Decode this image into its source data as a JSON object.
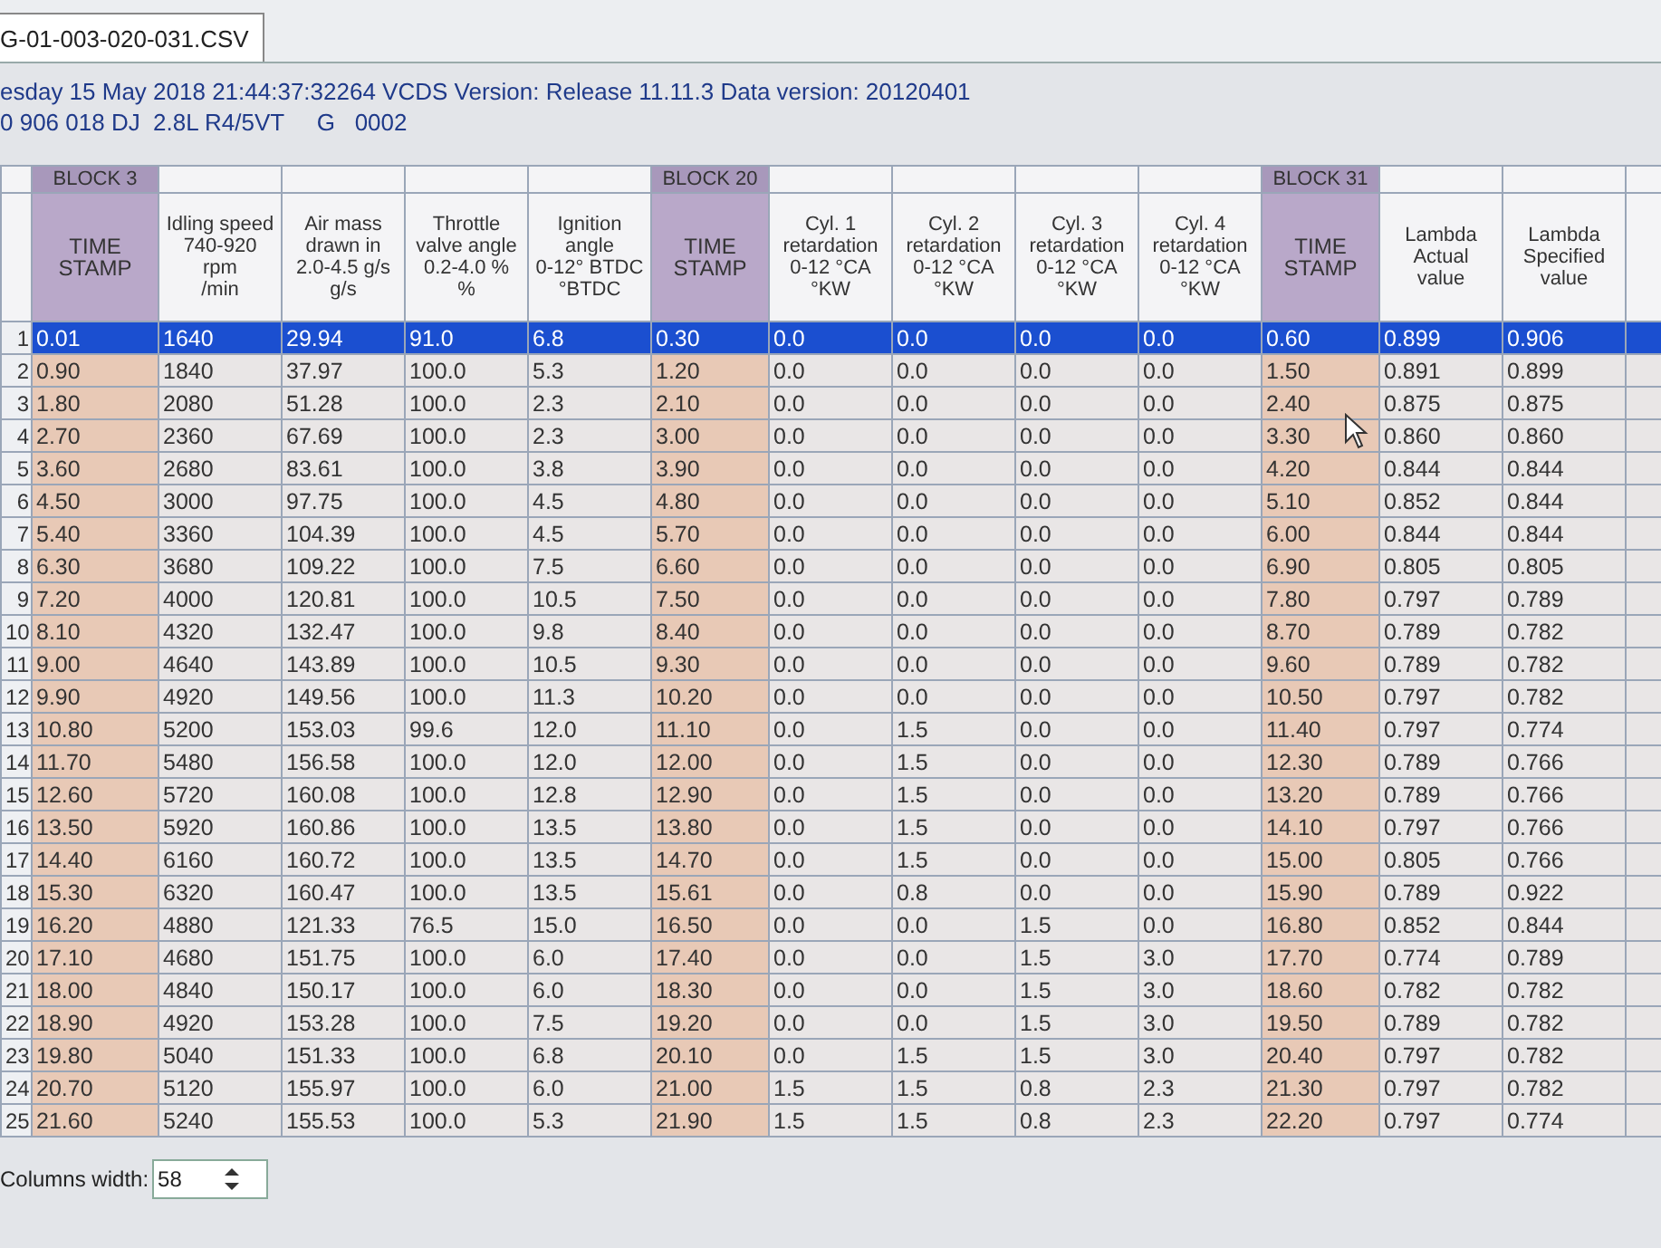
{
  "tab": {
    "label": "G-01-003-020-031.CSV",
    "selected": true
  },
  "info_lines": [
    "esday 15 May 2018 21:44:37:32264 VCDS Version: Release 11.11.3 Data version: 20120401",
    "0 906 018 DJ  2.8L R4/5VT     G   0002"
  ],
  "table": {
    "columns": [
      {
        "kind": "time",
        "block": "BLOCK 3",
        "header": [
          "TIME",
          "STAMP"
        ]
      },
      {
        "kind": "value",
        "header": [
          "Idling speed",
          "740-920",
          "rpm",
          "/min"
        ]
      },
      {
        "kind": "value",
        "header": [
          "Air mass",
          "drawn in",
          "2.0-4.5 g/s",
          "g/s"
        ]
      },
      {
        "kind": "value",
        "header": [
          "Throttle",
          "valve angle",
          "0.2-4.0 %",
          "%"
        ]
      },
      {
        "kind": "value",
        "header": [
          "Ignition",
          "angle",
          "0-12° BTDC",
          "°BTDC"
        ]
      },
      {
        "kind": "time",
        "block": "BLOCK 20",
        "header": [
          "TIME",
          "STAMP"
        ]
      },
      {
        "kind": "value",
        "header": [
          "Cyl. 1",
          "retardation",
          "0-12 °CA",
          "°KW"
        ]
      },
      {
        "kind": "value",
        "header": [
          "Cyl. 2",
          "retardation",
          "0-12 °CA",
          "°KW"
        ]
      },
      {
        "kind": "value",
        "header": [
          "Cyl. 3",
          "retardation",
          "0-12 °CA",
          "°KW"
        ]
      },
      {
        "kind": "value",
        "header": [
          "Cyl. 4",
          "retardation",
          "0-12 °CA",
          "°KW"
        ]
      },
      {
        "kind": "time",
        "block": "BLOCK 31",
        "header": [
          "TIME",
          "STAMP"
        ]
      },
      {
        "kind": "value",
        "header": [
          "Lambda",
          "Actual",
          "value"
        ]
      },
      {
        "kind": "value",
        "header": [
          "Lambda",
          "Specified",
          "value"
        ]
      }
    ],
    "rows": [
      {
        "number": "1",
        "selected": true,
        "cells": [
          "0.01",
          "1640",
          "29.94",
          "91.0",
          "6.8",
          "0.30",
          "0.0",
          "0.0",
          "0.0",
          "0.0",
          "0.60",
          "0.899",
          "0.906"
        ]
      },
      {
        "number": "2",
        "selected": false,
        "cells": [
          "0.90",
          "1840",
          "37.97",
          "100.0",
          "5.3",
          "1.20",
          "0.0",
          "0.0",
          "0.0",
          "0.0",
          "1.50",
          "0.891",
          "0.899"
        ]
      },
      {
        "number": "3",
        "selected": false,
        "cells": [
          "1.80",
          "2080",
          "51.28",
          "100.0",
          "2.3",
          "2.10",
          "0.0",
          "0.0",
          "0.0",
          "0.0",
          "2.40",
          "0.875",
          "0.875"
        ]
      },
      {
        "number": "4",
        "selected": false,
        "cells": [
          "2.70",
          "2360",
          "67.69",
          "100.0",
          "2.3",
          "3.00",
          "0.0",
          "0.0",
          "0.0",
          "0.0",
          "3.30",
          "0.860",
          "0.860"
        ]
      },
      {
        "number": "5",
        "selected": false,
        "cells": [
          "3.60",
          "2680",
          "83.61",
          "100.0",
          "3.8",
          "3.90",
          "0.0",
          "0.0",
          "0.0",
          "0.0",
          "4.20",
          "0.844",
          "0.844"
        ]
      },
      {
        "number": "6",
        "selected": false,
        "cells": [
          "4.50",
          "3000",
          "97.75",
          "100.0",
          "4.5",
          "4.80",
          "0.0",
          "0.0",
          "0.0",
          "0.0",
          "5.10",
          "0.852",
          "0.844"
        ]
      },
      {
        "number": "7",
        "selected": false,
        "cells": [
          "5.40",
          "3360",
          "104.39",
          "100.0",
          "4.5",
          "5.70",
          "0.0",
          "0.0",
          "0.0",
          "0.0",
          "6.00",
          "0.844",
          "0.844"
        ]
      },
      {
        "number": "8",
        "selected": false,
        "cells": [
          "6.30",
          "3680",
          "109.22",
          "100.0",
          "7.5",
          "6.60",
          "0.0",
          "0.0",
          "0.0",
          "0.0",
          "6.90",
          "0.805",
          "0.805"
        ]
      },
      {
        "number": "9",
        "selected": false,
        "cells": [
          "7.20",
          "4000",
          "120.81",
          "100.0",
          "10.5",
          "7.50",
          "0.0",
          "0.0",
          "0.0",
          "0.0",
          "7.80",
          "0.797",
          "0.789"
        ]
      },
      {
        "number": "10",
        "selected": false,
        "cells": [
          "8.10",
          "4320",
          "132.47",
          "100.0",
          "9.8",
          "8.40",
          "0.0",
          "0.0",
          "0.0",
          "0.0",
          "8.70",
          "0.789",
          "0.782"
        ]
      },
      {
        "number": "11",
        "selected": false,
        "cells": [
          "9.00",
          "4640",
          "143.89",
          "100.0",
          "10.5",
          "9.30",
          "0.0",
          "0.0",
          "0.0",
          "0.0",
          "9.60",
          "0.789",
          "0.782"
        ]
      },
      {
        "number": "12",
        "selected": false,
        "cells": [
          "9.90",
          "4920",
          "149.56",
          "100.0",
          "11.3",
          "10.20",
          "0.0",
          "0.0",
          "0.0",
          "0.0",
          "10.50",
          "0.797",
          "0.782"
        ]
      },
      {
        "number": "13",
        "selected": false,
        "cells": [
          "10.80",
          "5200",
          "153.03",
          "99.6",
          "12.0",
          "11.10",
          "0.0",
          "1.5",
          "0.0",
          "0.0",
          "11.40",
          "0.797",
          "0.774"
        ]
      },
      {
        "number": "14",
        "selected": false,
        "cells": [
          "11.70",
          "5480",
          "156.58",
          "100.0",
          "12.0",
          "12.00",
          "0.0",
          "1.5",
          "0.0",
          "0.0",
          "12.30",
          "0.789",
          "0.766"
        ]
      },
      {
        "number": "15",
        "selected": false,
        "cells": [
          "12.60",
          "5720",
          "160.08",
          "100.0",
          "12.8",
          "12.90",
          "0.0",
          "1.5",
          "0.0",
          "0.0",
          "13.20",
          "0.789",
          "0.766"
        ]
      },
      {
        "number": "16",
        "selected": false,
        "cells": [
          "13.50",
          "5920",
          "160.86",
          "100.0",
          "13.5",
          "13.80",
          "0.0",
          "1.5",
          "0.0",
          "0.0",
          "14.10",
          "0.797",
          "0.766"
        ]
      },
      {
        "number": "17",
        "selected": false,
        "cells": [
          "14.40",
          "6160",
          "160.72",
          "100.0",
          "13.5",
          "14.70",
          "0.0",
          "1.5",
          "0.0",
          "0.0",
          "15.00",
          "0.805",
          "0.766"
        ]
      },
      {
        "number": "18",
        "selected": false,
        "cells": [
          "15.30",
          "6320",
          "160.47",
          "100.0",
          "13.5",
          "15.61",
          "0.0",
          "0.8",
          "0.0",
          "0.0",
          "15.90",
          "0.789",
          "0.922"
        ]
      },
      {
        "number": "19",
        "selected": false,
        "cells": [
          "16.20",
          "4880",
          "121.33",
          "76.5",
          "15.0",
          "16.50",
          "0.0",
          "0.0",
          "1.5",
          "0.0",
          "16.80",
          "0.852",
          "0.844"
        ]
      },
      {
        "number": "20",
        "selected": false,
        "cells": [
          "17.10",
          "4680",
          "151.75",
          "100.0",
          "6.0",
          "17.40",
          "0.0",
          "0.0",
          "1.5",
          "3.0",
          "17.70",
          "0.774",
          "0.789"
        ]
      },
      {
        "number": "21",
        "selected": false,
        "cells": [
          "18.00",
          "4840",
          "150.17",
          "100.0",
          "6.0",
          "18.30",
          "0.0",
          "0.0",
          "1.5",
          "3.0",
          "18.60",
          "0.782",
          "0.782"
        ]
      },
      {
        "number": "22",
        "selected": false,
        "cells": [
          "18.90",
          "4920",
          "153.28",
          "100.0",
          "7.5",
          "19.20",
          "0.0",
          "0.0",
          "1.5",
          "3.0",
          "19.50",
          "0.789",
          "0.782"
        ]
      },
      {
        "number": "23",
        "selected": false,
        "cells": [
          "19.80",
          "5040",
          "151.33",
          "100.0",
          "6.8",
          "20.10",
          "0.0",
          "1.5",
          "1.5",
          "3.0",
          "20.40",
          "0.797",
          "0.782"
        ]
      },
      {
        "number": "24",
        "selected": false,
        "cells": [
          "20.70",
          "5120",
          "155.97",
          "100.0",
          "6.0",
          "21.00",
          "1.5",
          "1.5",
          "0.8",
          "2.3",
          "21.30",
          "0.797",
          "0.782"
        ]
      },
      {
        "number": "25",
        "selected": false,
        "cells": [
          "21.60",
          "5240",
          "155.53",
          "100.0",
          "5.3",
          "21.90",
          "1.5",
          "1.5",
          "0.8",
          "2.3",
          "22.20",
          "0.797",
          "0.774"
        ]
      }
    ]
  },
  "footer": {
    "label": "Columns width:",
    "value": "58"
  }
}
